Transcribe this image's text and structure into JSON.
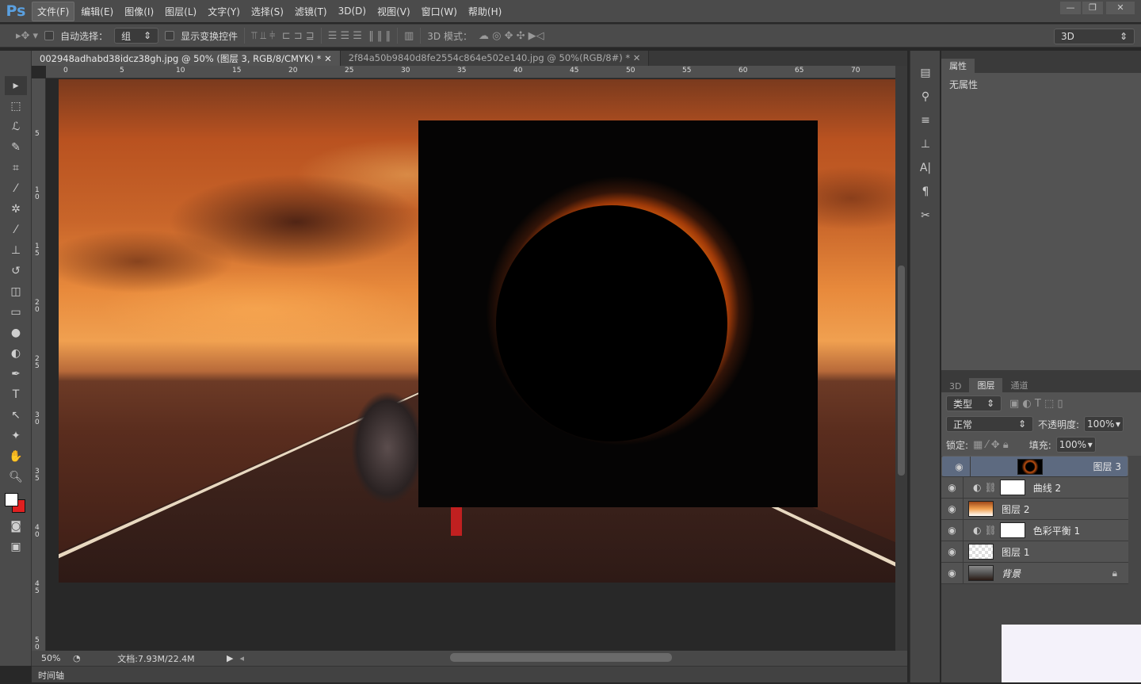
{
  "app": {
    "logo": "Ps"
  },
  "menu": [
    "文件(F)",
    "编辑(E)",
    "图像(I)",
    "图层(L)",
    "文字(Y)",
    "选择(S)",
    "滤镜(T)",
    "3D(D)",
    "视图(V)",
    "窗口(W)",
    "帮助(H)"
  ],
  "window_buttons": [
    "—",
    "❐",
    "✕"
  ],
  "options": {
    "auto_select_label": "自动选择：",
    "auto_select_value": "组",
    "show_transform_label": "显示变换控件",
    "mode_3d_label": "3D 模式：",
    "workspace": "3D"
  },
  "tabs": [
    {
      "label": "002948adhabd38idcz38gh.jpg @ 50% (图层 3, RGB/8/CMYK) *",
      "active": true
    },
    {
      "label": "2f84a50b9840d8fe2554c864e502e140.jpg @ 50%(RGB/8#) *",
      "active": false
    }
  ],
  "ruler_top": [
    "0",
    "5",
    "10",
    "15",
    "20",
    "25",
    "30",
    "35",
    "40",
    "45",
    "50",
    "55",
    "60",
    "65",
    "70"
  ],
  "ruler_left": [
    "5",
    "1 0",
    "1 5",
    "2 0",
    "2 5",
    "3 0",
    "3 5",
    "4 0",
    "4 5",
    "5 0"
  ],
  "status": {
    "zoom": "50%",
    "doc": "文档:7.93M/22.4M"
  },
  "timeline": {
    "label": "时间轴"
  },
  "properties": {
    "tab": "属性",
    "body": "无属性"
  },
  "layers_panel": {
    "tabs": [
      "3D",
      "图层",
      "通道"
    ],
    "active_tab": "图层",
    "filter": "类型",
    "blend_mode": "正常",
    "opacity_label": "不透明度:",
    "opacity": "100%",
    "lock_label": "锁定:",
    "fill_label": "填充:",
    "fill": "100%",
    "layers": [
      {
        "name": "图层 3",
        "type": "pixel",
        "selected": true,
        "visible": true
      },
      {
        "name": "曲线 2",
        "type": "adjustment",
        "selected": false,
        "visible": true
      },
      {
        "name": "图层 2",
        "type": "pixel",
        "selected": false,
        "visible": true
      },
      {
        "name": "色彩平衡 1",
        "type": "adjustment",
        "selected": false,
        "visible": true
      },
      {
        "name": "图层 1",
        "type": "pixel",
        "selected": false,
        "visible": true
      },
      {
        "name": "背景",
        "type": "background",
        "selected": false,
        "visible": true,
        "locked": true
      }
    ]
  },
  "colors": {
    "foreground": "#ffffff",
    "background": "#e02020",
    "selection": "#5d6a80"
  }
}
